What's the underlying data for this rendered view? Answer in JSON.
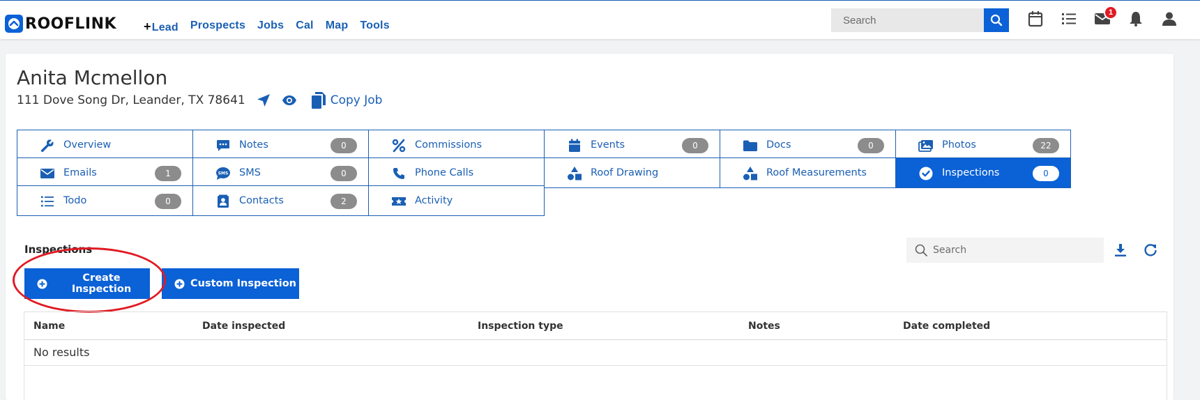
{
  "brand": {
    "name": "ROOFLINK"
  },
  "nav": {
    "lead_plus": "+",
    "lead": "Lead",
    "prospects": "Prospects",
    "jobs": "Jobs",
    "cal": "Cal",
    "map": "Map",
    "tools": "Tools"
  },
  "top_search": {
    "placeholder": "Search"
  },
  "notifications": {
    "mail_count": "1"
  },
  "customer": {
    "name": "Anita Mcmellon",
    "address": "111 Dove Song Dr, Leander, TX 78641",
    "copy_job": "Copy Job"
  },
  "tabs": [
    {
      "label": "Overview",
      "icon": "wrench-icon",
      "count": null
    },
    {
      "label": "Notes",
      "icon": "comment-icon",
      "count": "0"
    },
    {
      "label": "Commissions",
      "icon": "percent-icon",
      "count": null
    },
    {
      "label": "Events",
      "icon": "calendar-icon",
      "count": "0"
    },
    {
      "label": "Docs",
      "icon": "folder-icon",
      "count": "0"
    },
    {
      "label": "Photos",
      "icon": "images-icon",
      "count": "22"
    },
    {
      "label": "Emails",
      "icon": "envelope-icon",
      "count": "1"
    },
    {
      "label": "SMS",
      "icon": "sms-icon",
      "count": "0"
    },
    {
      "label": "Phone Calls",
      "icon": "phone-icon",
      "count": null
    },
    {
      "label": "Roof Drawing",
      "icon": "shapes-icon",
      "count": null
    },
    {
      "label": "Roof Measurements",
      "icon": "shapes-icon",
      "count": null
    },
    {
      "label": "Inspections",
      "icon": "check-circle-icon",
      "count": "0",
      "active": true
    },
    {
      "label": "Todo",
      "icon": "list-icon",
      "count": "0"
    },
    {
      "label": "Contacts",
      "icon": "contact-book-icon",
      "count": "2"
    },
    {
      "label": "Activity",
      "icon": "ticket-star-icon",
      "count": null
    }
  ],
  "inspections": {
    "title": "Inspections",
    "search_placeholder": "Search",
    "create_button": "Create Inspection",
    "custom_button": "Custom Inspection",
    "columns": [
      "Name",
      "Date inspected",
      "Inspection type",
      "Notes",
      "Date completed"
    ],
    "empty_text": "No results"
  },
  "colors": {
    "accent": "#0b61d6",
    "link": "#1a5fb4",
    "badge_gray": "#8c8c8c",
    "alert_red": "#e01b24"
  }
}
